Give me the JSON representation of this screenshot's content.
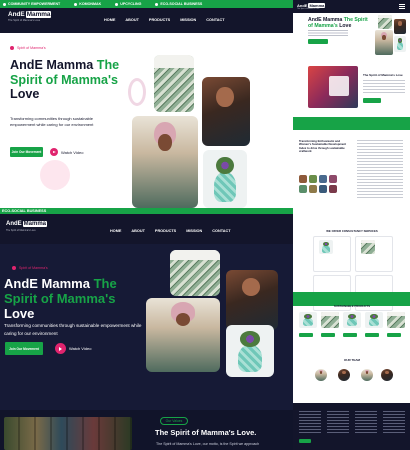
{
  "top_mockup": {
    "strip_items": [
      "COMMUNITY EMPOWERMENT",
      "KOMONMAK",
      "UPCYCLING",
      "ECO-SOCIAL BUSINESS"
    ],
    "logo": {
      "word1": "AndE",
      "word2": "Mamma",
      "tagline": "The Spirit of Mamma's Love"
    },
    "nav": [
      "HOME",
      "ABOUT",
      "PRODUCTS",
      "MISSION",
      "CONTACT"
    ],
    "eyebrow": "Spirit of Mamma's",
    "title_plain": "AndE Mamma ",
    "title_green": "The Spirit of Mamma's",
    "title_end": " Love",
    "description": "Transforming communities through sustainable empowerment while caring for our environment",
    "cta_label": "Join Our Movement",
    "watch_label": "Watch Video"
  },
  "right_column": {
    "logo": {
      "word1": "AndE",
      "word2": "Mamma",
      "tagline": "The Spirit of Mamma's Love"
    },
    "hero_title_plain": "AndE Mamma ",
    "hero_title_green": "The Spirit of Mamma's",
    "hero_title_end": " Love",
    "section_about": "The Spirit of Mamma's Love",
    "section_transform": "Transforming Enthusiastic and Women's Sustainable Development Index to drive through sustainable craftwork",
    "section_services": "WE OFFER CONSULTANCY SERVICES",
    "section_products": "SUSTAINABLE PRODUCTS",
    "section_team": "OUR TEAM"
  },
  "bottom_mockup": {
    "strip_text": "ECO-SOCIAL BUSINESS",
    "logo": {
      "word1": "AndE",
      "word2": "Mamma",
      "tagline": "The Spirit of Mamma's Love"
    },
    "nav": [
      "HOME",
      "ABOUT",
      "PRODUCTS",
      "MISSION",
      "CONTACT"
    ],
    "eyebrow": "Spirit of Mamma's",
    "title_plain": "AndE Mamma ",
    "title_green": "The Spirit of Mamma's",
    "title_end": " Love",
    "description": "Transforming communities through sustainable empowerment while caring for our environment",
    "cta_label": "Join Our Movement",
    "watch_label": "Watch Video",
    "section_pill": "Our Values",
    "section_title": "The Spirit of Mamma's Love.",
    "section_desc": "The Spirit of Mamma's Love, our motto, is the Spirit we approach"
  },
  "colors": {
    "brand_green": "#17a347",
    "navy": "#13152b",
    "accent_pink": "#e0246e"
  },
  "icons": [
    "play-icon",
    "menu-icon"
  ]
}
